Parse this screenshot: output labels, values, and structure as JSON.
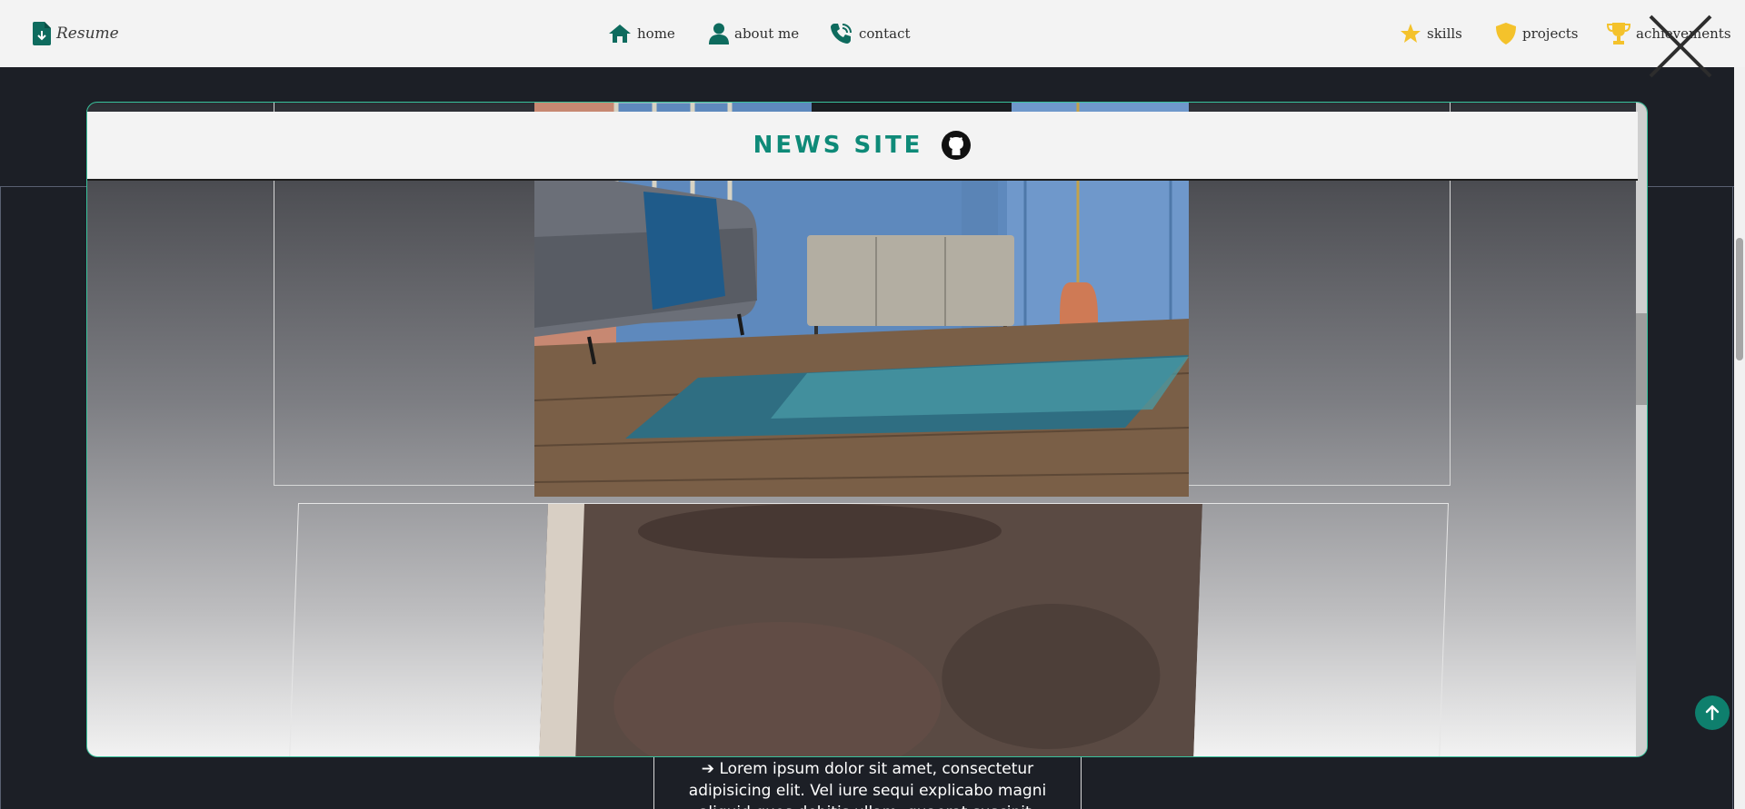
{
  "nav": {
    "brand_label": "Resume",
    "home_label": "home",
    "about_label": "about me",
    "contact_label": "contact",
    "skills_label": "skills",
    "projects_label": "projects",
    "achievements_label": "achievements"
  },
  "modal": {
    "title": "NEWS SITE",
    "github_icon": "github-icon"
  },
  "background": {
    "description_text": "➔ Lorem ipsum dolor sit amet, consectetur adipisicing elit. Vel iure sequi explicabo magni aliquid quos debitis ullam, quaerat suscipit, itaque in est"
  },
  "colors": {
    "accent": "#0e8a78",
    "page_bg": "#1c1f26",
    "nav_bg": "#f3f3f3",
    "gold": "#f4c22b"
  }
}
